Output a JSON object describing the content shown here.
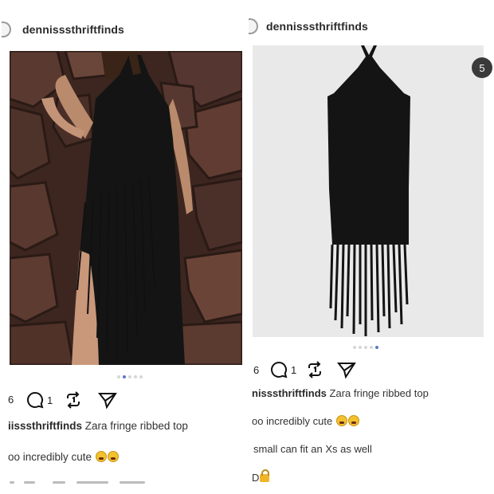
{
  "left_post": {
    "username": "dennisssthriftfinds",
    "carousel": {
      "count": 5,
      "active": 1
    },
    "actions": {
      "likes_partial": "6",
      "comments": "1"
    },
    "caption": {
      "user_partial": "iisssthriftfinds",
      "text": "Zara fringe ribbed top"
    },
    "line2": "oo incredibly cute"
  },
  "right_post": {
    "username": "dennisssthriftfinds",
    "carousel": {
      "count": 5,
      "active": 4
    },
    "next_badge": "5",
    "actions": {
      "likes_partial": "6",
      "comments": "1"
    },
    "caption": {
      "user_partial": "nisssthriftfinds",
      "text": "Zara fringe ribbed top"
    },
    "line2": "oo incredibly cute",
    "line3": "small can fit an Xs as well",
    "line4": "D"
  },
  "colors": {
    "accent": "#5a78c8",
    "dress": "#141414",
    "rock": "#4a2e26"
  },
  "icons": [
    "comment-icon",
    "repost-icon",
    "share-icon",
    "avatar-icon",
    "lock-icon",
    "weary-face-emoji"
  ]
}
